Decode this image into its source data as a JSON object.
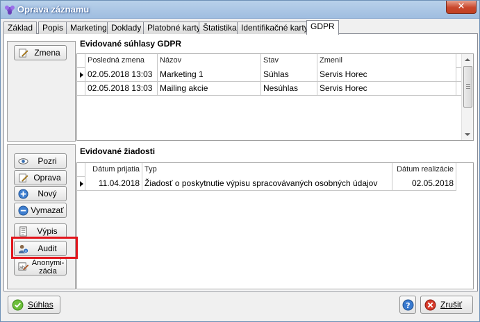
{
  "window": {
    "title": "Oprava záznamu",
    "close_label": "✕"
  },
  "tabs": [
    "Základ",
    "Popis",
    "Marketing",
    "Doklady",
    "Platobné karty",
    "Štatistika",
    "Identifikačné karty",
    "GDPR"
  ],
  "consents": {
    "title": "Evidované súhlasy GDPR",
    "columns": [
      "Posledná zmena",
      "Názov",
      "Stav",
      "Zmenil"
    ],
    "rows": [
      [
        "02.05.2018 13:03",
        "Marketing 1",
        "Súhlas",
        "Servis Horec"
      ],
      [
        "02.05.2018 13:03",
        "Mailing akcie",
        "Nesúhlas",
        "Servis Horec"
      ]
    ],
    "edit_button": "Zmena"
  },
  "requests": {
    "title": "Evidované žiadosti",
    "columns": [
      "Dátum prijatia",
      "Typ",
      "Dátum realizácie"
    ],
    "rows": [
      [
        "11.04.2018",
        "Žiadosť o poskytnutie výpisu spracovávaných osobných údajov",
        "02.05.2018"
      ]
    ]
  },
  "side_buttons": {
    "view": "Pozri",
    "edit": "Oprava",
    "new": "Nový",
    "delete": "Vymazať",
    "report": "Výpis",
    "audit": "Audit",
    "anonymize_line1": "Anonymi-",
    "anonymize_line2": "zácia"
  },
  "footer": {
    "consent_button": "Súhlas",
    "help_icon": "help-icon",
    "cancel_button": "Zrušiť"
  },
  "colors": {
    "highlight": "#e2141b",
    "title_bar": "#9fbde0"
  }
}
